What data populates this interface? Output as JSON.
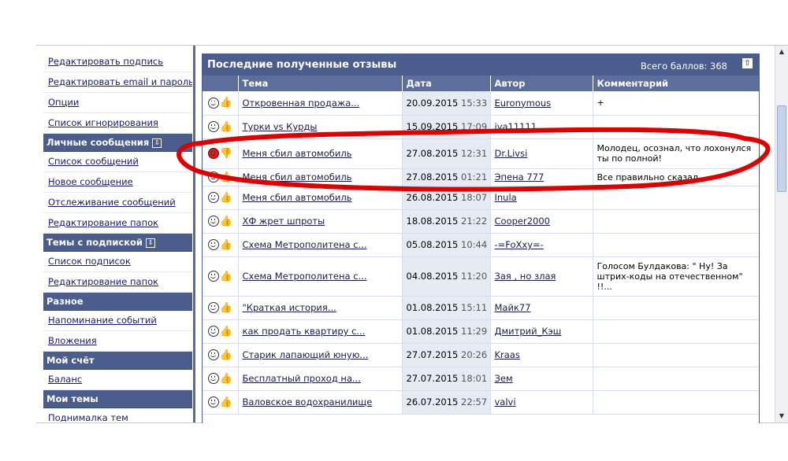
{
  "sidebar": {
    "items": [
      {
        "type": "item",
        "label": "Редактировать подпись"
      },
      {
        "type": "item",
        "label": "Редактировать email и пароль"
      },
      {
        "type": "item",
        "label": "Опции"
      },
      {
        "type": "item",
        "label": "Список игнорирования"
      },
      {
        "type": "header",
        "label": "Личные сообщения"
      },
      {
        "type": "item",
        "label": "Список сообщений"
      },
      {
        "type": "item",
        "label": "Новое сообщение"
      },
      {
        "type": "item",
        "label": "Отслеживание сообщений"
      },
      {
        "type": "item",
        "label": "Редактирование папок"
      },
      {
        "type": "header",
        "label": "Темы с подпиской"
      },
      {
        "type": "item",
        "label": "Список подписок"
      },
      {
        "type": "item",
        "label": "Редактирование папок"
      },
      {
        "type": "header",
        "label": "Разное"
      },
      {
        "type": "item",
        "label": "Напоминание событий"
      },
      {
        "type": "item",
        "label": "Вложения"
      },
      {
        "type": "header",
        "label": "Мой счёт"
      },
      {
        "type": "item",
        "label": "Баланс"
      },
      {
        "type": "header",
        "label": "Мои темы"
      },
      {
        "type": "item",
        "label": "Поднималка тем"
      }
    ]
  },
  "panel": {
    "title": "Последние полученные отзывы",
    "score": "Всего баллов: 368",
    "columns": [
      "Тема",
      "Дата",
      "Автор",
      "Комментарий"
    ]
  },
  "rows": [
    {
      "icon": "positive",
      "topic": "Откровенная продажа...",
      "date": "20.09.2015",
      "time": "15:33",
      "author": "Euronymous",
      "comment": "+"
    },
    {
      "icon": "positive",
      "topic": "Турки vs Курды",
      "date": "15.09.2015",
      "time": "17:09",
      "author": "iva11111",
      "comment": ""
    },
    {
      "icon": "negative",
      "topic": "Меня сбил автомобиль",
      "date": "27.08.2015",
      "time": "12:31",
      "author": "Dr.Livsi",
      "comment": "Молодец, осознал, что лохонулся ты по полной!"
    },
    {
      "icon": "positive",
      "topic": "Меня сбил автомобиль",
      "date": "27.08.2015",
      "time": "01:21",
      "author": "Эпена 777",
      "comment": "Все правильно сказал"
    },
    {
      "icon": "positive",
      "topic": "Меня сбил автомобиль",
      "date": "26.08.2015",
      "time": "18:07",
      "author": "Inula",
      "comment": ""
    },
    {
      "icon": "positive",
      "topic": "ХФ жрет шпроты",
      "date": "18.08.2015",
      "time": "21:22",
      "author": "Cooper2000",
      "comment": ""
    },
    {
      "icon": "positive",
      "topic": "Схема Метрополитена с...",
      "date": "05.08.2015",
      "time": "10:44",
      "author": "-=FoXxy=-",
      "comment": ""
    },
    {
      "icon": "positive",
      "topic": "Схема Метрополитена с...",
      "date": "04.08.2015",
      "time": "11:20",
      "author": "Зая , но злая",
      "comment": "Голосом Булдакова: \" Ну! За штрих-коды на отечественном\" !!..."
    },
    {
      "icon": "positive",
      "topic": "\"Краткая история...",
      "date": "01.08.2015",
      "time": "15:11",
      "author": "Майк77",
      "comment": ""
    },
    {
      "icon": "positive",
      "topic": "как продать квартиру с...",
      "date": "01.08.2015",
      "time": "11:29",
      "author": "Дмитрий_Кэш",
      "comment": ""
    },
    {
      "icon": "positive",
      "topic": "Старик лапающий юную...",
      "date": "27.07.2015",
      "time": "20:26",
      "author": "Kraas",
      "comment": ""
    },
    {
      "icon": "positive",
      "topic": "Бесплатный проход на...",
      "date": "27.07.2015",
      "time": "18:01",
      "author": "Зем",
      "comment": ""
    },
    {
      "icon": "positive",
      "topic": "Валовское водохранилище",
      "date": "26.07.2015",
      "time": "22:57",
      "author": "valvi",
      "comment": ""
    }
  ],
  "colors": {
    "header_bg": "#4a5d8c",
    "column_header_bg": "#5b6e9c",
    "date_cell_bg": "#e6ebf3",
    "annotation": "#e00000"
  }
}
